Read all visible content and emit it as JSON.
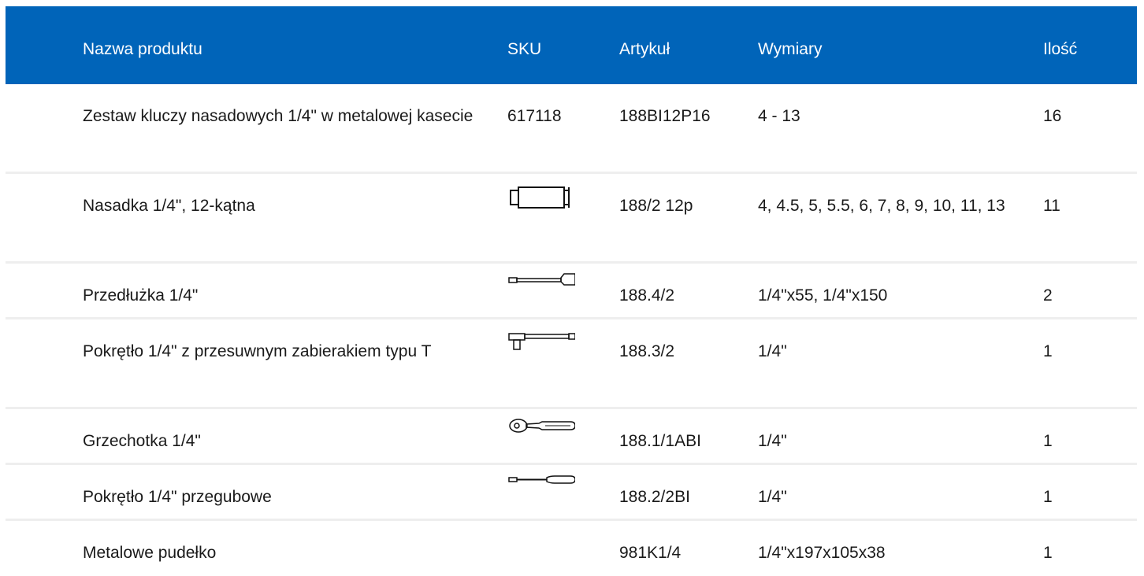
{
  "header": {
    "name": "Nazwa produktu",
    "sku": "SKU",
    "article": "Artykuł",
    "dimensions": "Wymiary",
    "quantity": "Ilość"
  },
  "colors": {
    "header_bg": "#0064b9",
    "header_text": "#ffffff",
    "divider": "#eeeeee"
  },
  "rows": [
    {
      "name": "Zestaw kluczy nasadowych 1/4\" w metalowej kasecie",
      "sku": "617118",
      "sku_icon": "",
      "article": "188BI12P16",
      "dimensions": "4 - 13",
      "quantity": "16"
    },
    {
      "name": "Nasadka 1/4\", 12-kątna",
      "sku": "",
      "sku_icon": "socket-icon",
      "article": "188/2 12p",
      "dimensions": "4, 4.5, 5, 5.5, 6, 7, 8, 9, 10, 11, 13",
      "quantity": "11"
    },
    {
      "name": "Przedłużka 1/4\"",
      "sku": "",
      "sku_icon": "extension-bar-icon",
      "article": "188.4/2",
      "dimensions": "1/4\"x55, 1/4\"x150",
      "quantity": "2"
    },
    {
      "name": "Pokrętło 1/4\" z przesuwnym zabierakiem typu T",
      "sku": "",
      "sku_icon": "t-handle-icon",
      "article": "188.3/2",
      "dimensions": "1/4\"",
      "quantity": "1"
    },
    {
      "name": "Grzechotka 1/4\"",
      "sku": "",
      "sku_icon": "ratchet-icon",
      "article": "188.1/1ABI",
      "dimensions": "1/4\"",
      "quantity": "1"
    },
    {
      "name": "Pokrętło 1/4\" przegubowe",
      "sku": "",
      "sku_icon": "hinged-handle-icon",
      "article": "188.2/2BI",
      "dimensions": "1/4\"",
      "quantity": "1"
    },
    {
      "name": "Metalowe pudełko",
      "sku": "",
      "sku_icon": "",
      "article": "981K1/4",
      "dimensions": "1/4\"x197x105x38",
      "quantity": "1"
    }
  ]
}
